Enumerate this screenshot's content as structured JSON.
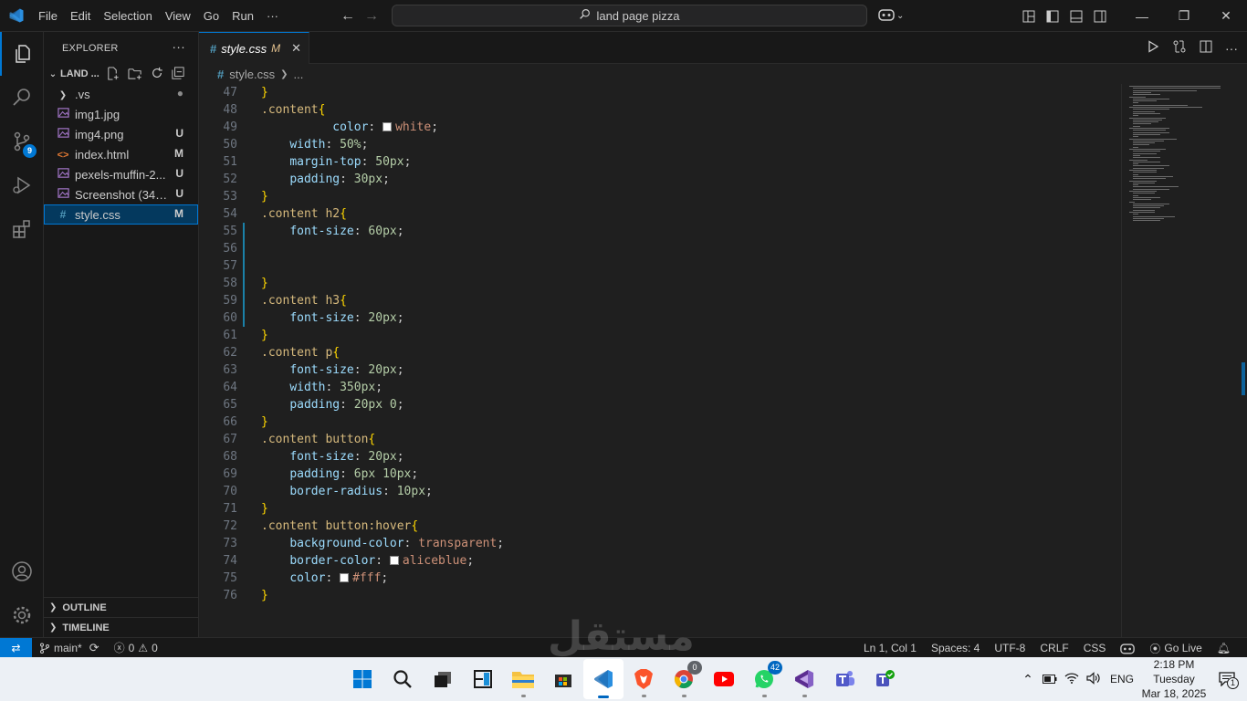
{
  "titlebar": {
    "menu": [
      "File",
      "Edit",
      "Selection",
      "View",
      "Go",
      "Run",
      "···"
    ],
    "search_text": "land page pizza"
  },
  "activity": {
    "source_control_badge": "9"
  },
  "explorer": {
    "header": "EXPLORER",
    "folder": "LAND ...",
    "files": [
      {
        "name": ".vs",
        "icon": "chevron-right",
        "status": "●",
        "status_color": "#8b8b8b"
      },
      {
        "name": "img1.jpg",
        "icon": "image",
        "status": "",
        "status_color": "#cccccc"
      },
      {
        "name": "img4.png",
        "icon": "image",
        "status": "U",
        "status_color": "#cccccc"
      },
      {
        "name": "index.html",
        "icon": "html",
        "status": "M",
        "status_color": "#cccccc"
      },
      {
        "name": "pexels-muffin-2...",
        "icon": "image",
        "status": "U",
        "status_color": "#cccccc"
      },
      {
        "name": "Screenshot (342)...",
        "icon": "image",
        "status": "U",
        "status_color": "#cccccc"
      },
      {
        "name": "style.css",
        "icon": "css",
        "status": "M",
        "status_color": "#cccccc"
      }
    ],
    "outline": "OUTLINE",
    "timeline": "TIMELINE"
  },
  "editor": {
    "tab_name": "style.css",
    "tab_status": "M",
    "breadcrumb_file": "style.css",
    "breadcrumb_more": "...",
    "lines": [
      {
        "n": "47",
        "t": [
          [
            "}",
            "brace"
          ]
        ]
      },
      {
        "n": "48",
        "t": [
          [
            ".content",
            "sel"
          ],
          [
            "{",
            "brace"
          ]
        ]
      },
      {
        "n": "49",
        "t": [
          [
            "          ",
            ""
          ],
          [
            "color",
            "prop"
          ],
          [
            ": ",
            ""
          ],
          [
            "SW",
            "swatch"
          ],
          [
            "white",
            "val"
          ],
          [
            ";",
            ""
          ]
        ]
      },
      {
        "n": "50",
        "t": [
          [
            "    ",
            ""
          ],
          [
            "width",
            "prop"
          ],
          [
            ": ",
            ""
          ],
          [
            "50%",
            "num"
          ],
          [
            ";",
            ""
          ]
        ]
      },
      {
        "n": "51",
        "t": [
          [
            "    ",
            ""
          ],
          [
            "margin-top",
            "prop"
          ],
          [
            ": ",
            ""
          ],
          [
            "50px",
            "num"
          ],
          [
            ";",
            ""
          ]
        ]
      },
      {
        "n": "52",
        "t": [
          [
            "    ",
            ""
          ],
          [
            "padding",
            "prop"
          ],
          [
            ": ",
            ""
          ],
          [
            "30px",
            "num"
          ],
          [
            ";",
            ""
          ]
        ]
      },
      {
        "n": "53",
        "t": [
          [
            "}",
            "brace"
          ]
        ]
      },
      {
        "n": "54",
        "t": [
          [
            ".content h2",
            "sel"
          ],
          [
            "{",
            "brace"
          ]
        ]
      },
      {
        "n": "55",
        "t": [
          [
            "    ",
            ""
          ],
          [
            "font-size",
            "prop"
          ],
          [
            ": ",
            ""
          ],
          [
            "60px",
            "num"
          ],
          [
            ";",
            ""
          ]
        ]
      },
      {
        "n": "56",
        "t": []
      },
      {
        "n": "57",
        "t": []
      },
      {
        "n": "58",
        "t": [
          [
            "}",
            "brace"
          ]
        ]
      },
      {
        "n": "59",
        "t": [
          [
            ".content h3",
            "sel"
          ],
          [
            "{",
            "brace"
          ]
        ]
      },
      {
        "n": "60",
        "t": [
          [
            "    ",
            ""
          ],
          [
            "font-size",
            "prop"
          ],
          [
            ": ",
            ""
          ],
          [
            "20px",
            "num"
          ],
          [
            ";",
            ""
          ]
        ]
      },
      {
        "n": "61",
        "t": [
          [
            "}",
            "brace"
          ]
        ]
      },
      {
        "n": "62",
        "t": [
          [
            ".content p",
            "sel"
          ],
          [
            "{",
            "brace"
          ]
        ]
      },
      {
        "n": "63",
        "t": [
          [
            "    ",
            ""
          ],
          [
            "font-size",
            "prop"
          ],
          [
            ": ",
            ""
          ],
          [
            "20px",
            "num"
          ],
          [
            ";",
            ""
          ]
        ]
      },
      {
        "n": "64",
        "t": [
          [
            "    ",
            ""
          ],
          [
            "width",
            "prop"
          ],
          [
            ": ",
            ""
          ],
          [
            "350px",
            "num"
          ],
          [
            ";",
            ""
          ]
        ]
      },
      {
        "n": "65",
        "t": [
          [
            "    ",
            ""
          ],
          [
            "padding",
            "prop"
          ],
          [
            ": ",
            ""
          ],
          [
            "20px 0",
            "num"
          ],
          [
            ";",
            ""
          ]
        ]
      },
      {
        "n": "66",
        "t": [
          [
            "}",
            "brace"
          ]
        ]
      },
      {
        "n": "67",
        "t": [
          [
            ".content button",
            "sel"
          ],
          [
            "{",
            "brace"
          ]
        ]
      },
      {
        "n": "68",
        "t": [
          [
            "    ",
            ""
          ],
          [
            "font-size",
            "prop"
          ],
          [
            ": ",
            ""
          ],
          [
            "20px",
            "num"
          ],
          [
            ";",
            ""
          ]
        ]
      },
      {
        "n": "69",
        "t": [
          [
            "    ",
            ""
          ],
          [
            "padding",
            "prop"
          ],
          [
            ": ",
            ""
          ],
          [
            "6px 10px",
            "num"
          ],
          [
            ";",
            ""
          ]
        ]
      },
      {
        "n": "70",
        "t": [
          [
            "    ",
            ""
          ],
          [
            "border-radius",
            "prop"
          ],
          [
            ": ",
            ""
          ],
          [
            "10px",
            "num"
          ],
          [
            ";",
            ""
          ]
        ]
      },
      {
        "n": "71",
        "t": [
          [
            "}",
            "brace"
          ]
        ]
      },
      {
        "n": "72",
        "t": [
          [
            ".content button:hover",
            "sel"
          ],
          [
            "{",
            "brace"
          ]
        ]
      },
      {
        "n": "73",
        "t": [
          [
            "    ",
            ""
          ],
          [
            "background-color",
            "prop"
          ],
          [
            ": ",
            ""
          ],
          [
            "transparent",
            "val"
          ],
          [
            ";",
            ""
          ]
        ]
      },
      {
        "n": "74",
        "t": [
          [
            "    ",
            ""
          ],
          [
            "border-color",
            "prop"
          ],
          [
            ": ",
            ""
          ],
          [
            "SW",
            "swatch"
          ],
          [
            "aliceblue",
            "val"
          ],
          [
            ";",
            ""
          ]
        ]
      },
      {
        "n": "75",
        "t": [
          [
            "    ",
            ""
          ],
          [
            "color",
            "prop"
          ],
          [
            ": ",
            ""
          ],
          [
            "SW",
            "swatch"
          ],
          [
            "#fff",
            "val"
          ],
          [
            ";",
            ""
          ]
        ]
      },
      {
        "n": "76",
        "t": [
          [
            "}",
            "brace"
          ]
        ]
      }
    ]
  },
  "statusbar": {
    "branch": "main*",
    "errors": "0",
    "warnings": "0",
    "position": "Ln 1, Col 1",
    "spaces": "Spaces: 4",
    "encoding": "UTF-8",
    "eol": "CRLF",
    "language": "CSS",
    "golive": "Go Live"
  },
  "taskbar": {
    "whatsapp_badge": "42",
    "chrome_badge": "0",
    "lang": "ENG",
    "time": "2:18 PM",
    "day": "Tuesday",
    "date": "Mar 18, 2025",
    "notif_count": "1"
  },
  "watermark": "مستقل"
}
